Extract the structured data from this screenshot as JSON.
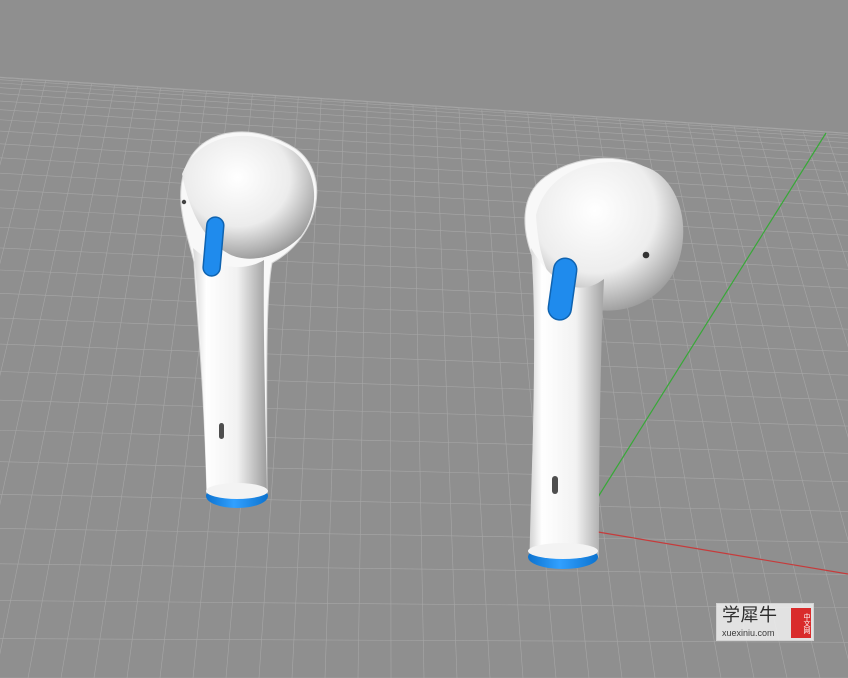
{
  "scene": {
    "background_color": "#8f8f8f",
    "grid_color": "#a7a7a7",
    "axis_x_color": "#c63b3b",
    "axis_y_color": "#38a838",
    "model_body_color": "#f5f5f5",
    "model_shadow_color": "#a9a9a9",
    "accent_blue": "#1d86e0"
  },
  "watermark": {
    "title": "学犀牛",
    "domain": "xuexiniu.com",
    "badge": "中文网"
  }
}
